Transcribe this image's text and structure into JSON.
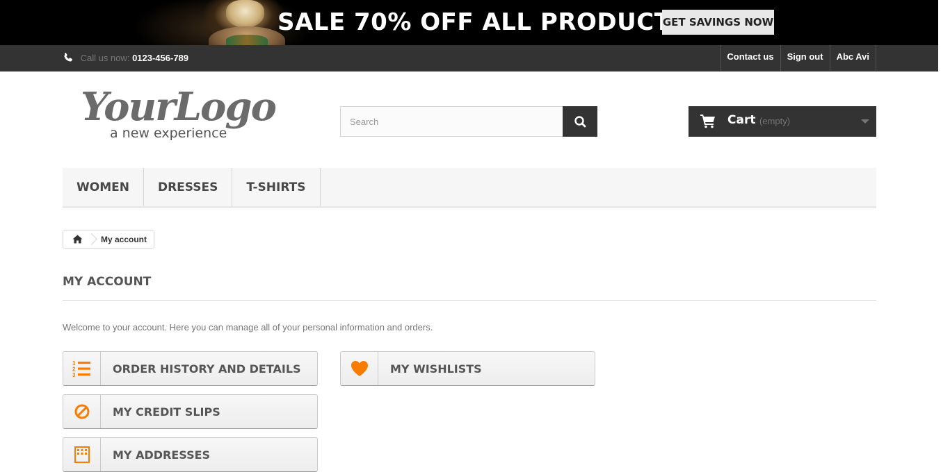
{
  "banner": {
    "headline": "SALE 70% OFF ALL PRODUCTS",
    "cta": "GET SAVINGS NOW"
  },
  "topbar": {
    "call_label": "Call us now:",
    "phone": "0123-456-789",
    "links": [
      "Contact us",
      "Sign out",
      "Abc Avi"
    ]
  },
  "logo": {
    "script": "YourLogo",
    "tagline": "a new experience"
  },
  "search": {
    "placeholder": "Search",
    "value": ""
  },
  "cart": {
    "label": "Cart",
    "status": "(empty)"
  },
  "menu": [
    "Women",
    "Dresses",
    "T-shirts"
  ],
  "breadcrumb": {
    "current": "My account"
  },
  "page": {
    "title": "My account",
    "intro": "Welcome to your account. Here you can manage all of your personal information and orders."
  },
  "account_links": {
    "order_history": "Order history and details",
    "wishlists": "My wishlists",
    "credit_slips": "My credit slips",
    "addresses": "My addresses"
  },
  "icons": {
    "phone": "phone-icon",
    "search": "search-icon",
    "cart": "cart-icon",
    "home": "home-icon",
    "order_list": "ordered-list-icon",
    "wishlist": "heart-icon",
    "credit": "ban-icon",
    "address": "building-icon"
  },
  "colors": {
    "accent": "#f97b00",
    "dark": "#333333",
    "banner_bg": "#000000"
  }
}
